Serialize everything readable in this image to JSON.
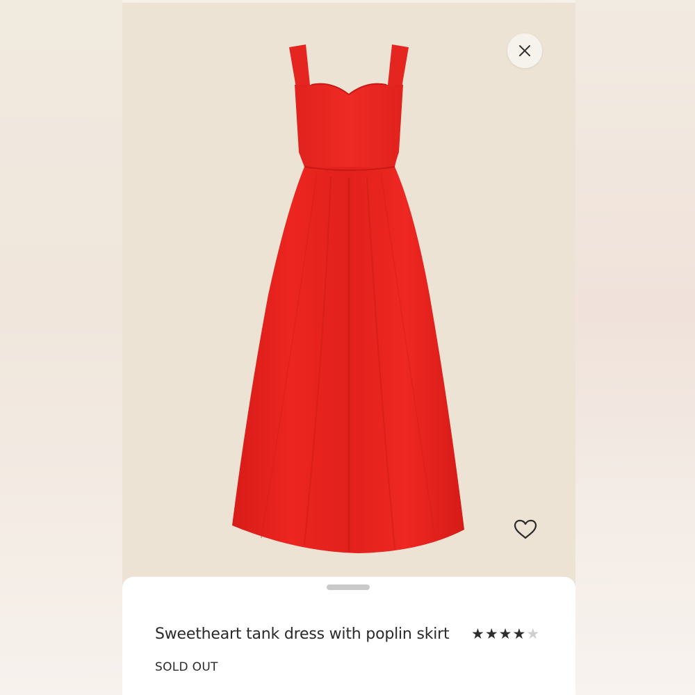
{
  "product": {
    "title": "Sweetheart tank dress with poplin skirt",
    "status": "SOLD OUT",
    "rating": 4.5,
    "rating_max": 5
  },
  "icons": {
    "close": "close-icon",
    "favorite": "heart-icon",
    "rating_star": "star-icon"
  },
  "colors": {
    "dress": "#e8231e",
    "image_background": "#ede3d4",
    "sheet_background": "#ffffff",
    "text": "#2a2a2a"
  }
}
